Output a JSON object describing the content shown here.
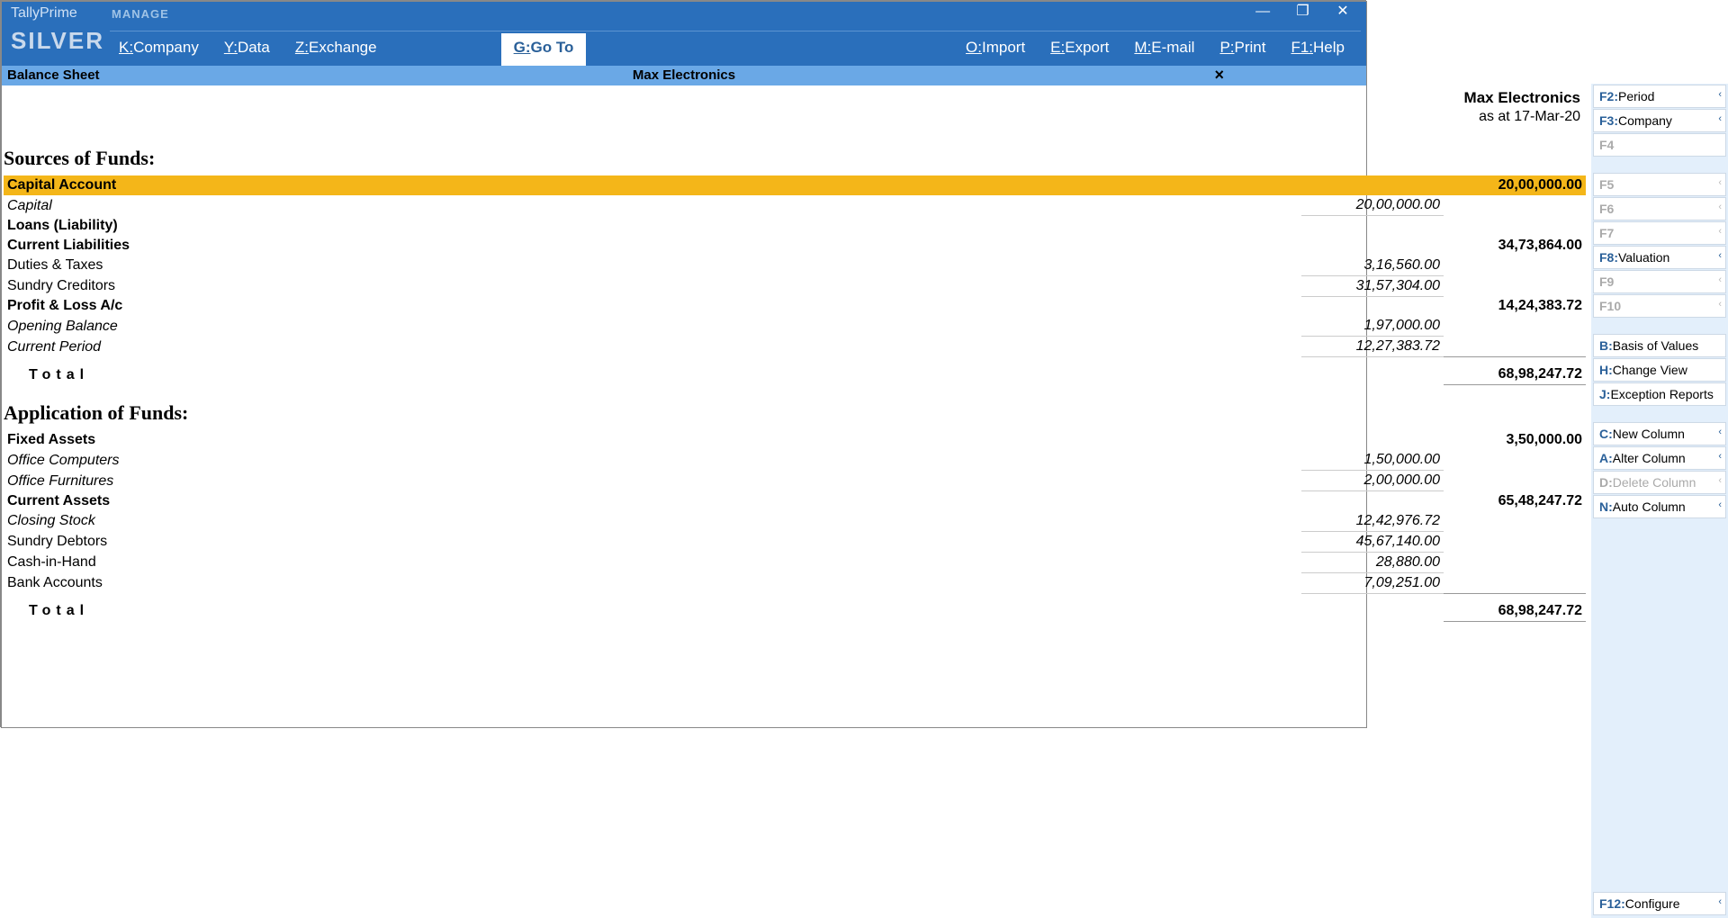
{
  "app": {
    "name": "TallyPrime",
    "edition": "SILVER",
    "manage": "MANAGE"
  },
  "menu": {
    "company": {
      "k": "K:",
      "t": "Company"
    },
    "data": {
      "k": "Y:",
      "t": "Data"
    },
    "exchange": {
      "k": "Z:",
      "t": "Exchange"
    },
    "goto": {
      "k": "G:",
      "t": "Go To"
    },
    "import": {
      "k": "O:",
      "t": "Import"
    },
    "export": {
      "k": "E:",
      "t": "Export"
    },
    "email": {
      "k": "M:",
      "t": "E-mail"
    },
    "print": {
      "k": "P:",
      "t": "Print"
    },
    "help": {
      "k": "F1:",
      "t": "Help"
    }
  },
  "subbar": {
    "title": "Balance Sheet",
    "company": "Max Electronics"
  },
  "header": {
    "company": "Max Electronics",
    "asat": "as at 17-Mar-20"
  },
  "sections": {
    "sources": "Sources of Funds:",
    "application": "Application of Funds:"
  },
  "src": {
    "capital": {
      "lbl": "Capital Account",
      "amt": "20,00,000.00",
      "sub": [
        {
          "lbl": "Capital",
          "amt": "20,00,000.00"
        }
      ]
    },
    "loans": {
      "lbl": "Loans (Liability)",
      "amt": ""
    },
    "curliab": {
      "lbl": "Current Liabilities",
      "amt": "34,73,864.00",
      "sub": [
        {
          "lbl": "Duties & Taxes",
          "amt": "3,16,560.00"
        },
        {
          "lbl": "Sundry Creditors",
          "amt": "31,57,304.00"
        }
      ]
    },
    "pl": {
      "lbl": "Profit & Loss A/c",
      "amt": "14,24,383.72",
      "sub": [
        {
          "lbl": "Opening Balance",
          "amt": "1,97,000.00"
        },
        {
          "lbl": "Current Period",
          "amt": "12,27,383.72"
        }
      ]
    },
    "total": {
      "lbl": "Total",
      "amt": "68,98,247.72"
    }
  },
  "app2": {
    "fixed": {
      "lbl": "Fixed Assets",
      "amt": "3,50,000.00",
      "sub": [
        {
          "lbl": "Office Computers",
          "amt": "1,50,000.00"
        },
        {
          "lbl": "Office Furnitures",
          "amt": "2,00,000.00"
        }
      ]
    },
    "cur": {
      "lbl": "Current Assets",
      "amt": "65,48,247.72",
      "sub": [
        {
          "lbl": "Closing Stock",
          "amt": "12,42,976.72"
        },
        {
          "lbl": "Sundry Debtors",
          "amt": "45,67,140.00"
        },
        {
          "lbl": "Cash-in-Hand",
          "amt": "28,880.00"
        },
        {
          "lbl": "Bank Accounts",
          "amt": "7,09,251.00"
        }
      ]
    },
    "total": {
      "lbl": "Total",
      "amt": "68,98,247.72"
    }
  },
  "rpanel": [
    {
      "k": "F2:",
      "t": "Period",
      "on": true,
      "caret": true
    },
    {
      "k": "F3:",
      "t": "Company",
      "on": true,
      "caret": true
    },
    {
      "k": "F4",
      "t": "",
      "on": false
    },
    {
      "gap": true
    },
    {
      "k": "F5",
      "t": "",
      "on": false,
      "caret": true
    },
    {
      "k": "F6",
      "t": "",
      "on": false,
      "caret": true
    },
    {
      "k": "F7",
      "t": "",
      "on": false,
      "caret": true
    },
    {
      "k": "F8:",
      "t": "Valuation",
      "on": true,
      "caret": true
    },
    {
      "k": "F9",
      "t": "",
      "on": false,
      "caret": true
    },
    {
      "k": "F10",
      "t": "",
      "on": false,
      "caret": true
    },
    {
      "gap": true
    },
    {
      "k": "B:",
      "t": "Basis of Values",
      "on": true
    },
    {
      "k": "H:",
      "t": "Change View",
      "on": true
    },
    {
      "k": "J:",
      "t": "Exception Reports",
      "on": true
    },
    {
      "gap": true
    },
    {
      "k": "C:",
      "t": "New Column",
      "on": true,
      "caret": true
    },
    {
      "k": "A:",
      "t": "Alter Column",
      "on": true,
      "caret": true
    },
    {
      "k": "D:",
      "t": "Delete Column",
      "on": false,
      "caret": true
    },
    {
      "k": "N:",
      "t": "Auto Column",
      "on": true,
      "caret": true
    }
  ],
  "rpanel_bottom": {
    "k": "F12:",
    "t": "Configure",
    "on": true,
    "caret": true
  }
}
